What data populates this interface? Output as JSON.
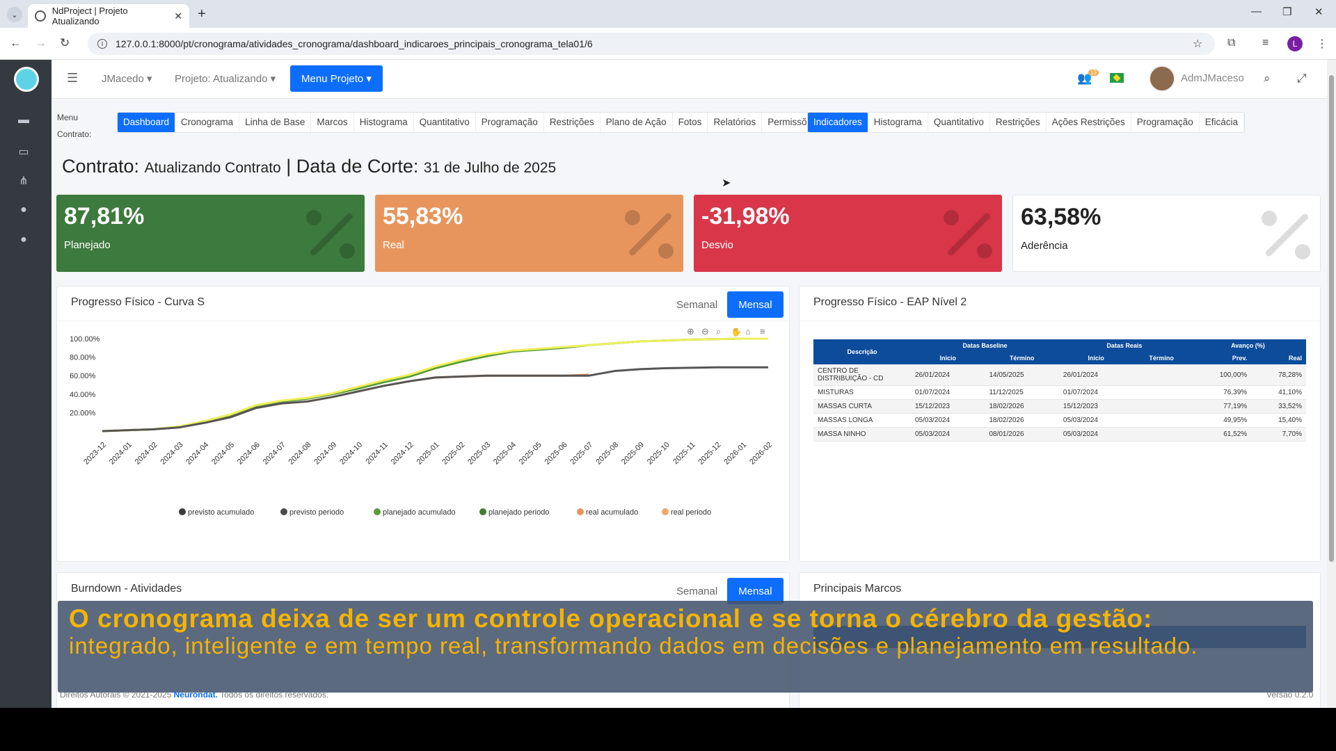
{
  "browser": {
    "tab_title": "NdProject | Projeto Atualizando",
    "url": "127.0.0.1:8000/pt/cronograma/atividades_cronograma/dashboard_indicaroes_principais_cronograma_tela01/6",
    "profile_initial": "L"
  },
  "header": {
    "user_dropdown": "JMacedo",
    "project_dropdown": "Projeto: Atualizando",
    "menu_button": "Menu Projeto",
    "notifications_count": "13",
    "username": "AdmJMaceso"
  },
  "submenu": {
    "label_line1": "Menu",
    "label_line2": "Contrato:",
    "group1": [
      "Dashboard",
      "Cronograma",
      "Linha de Base",
      "Marcos",
      "Histograma",
      "Quantitativo",
      "Programação",
      "Restrições",
      "Plano de Ação",
      "Fotos",
      "Relatórios",
      "Permissões"
    ],
    "group2": [
      "Indicadores",
      "Histograma",
      "Quantitativo",
      "Restrições",
      "Ações Restrições",
      "Programação",
      "Eficácia"
    ]
  },
  "contract": {
    "label": "Contrato:",
    "name": "Atualizando Contrato",
    "separator": "|",
    "cut_label": "Data de Corte:",
    "cut_date": "31 de Julho de 2025"
  },
  "kpis": [
    {
      "value": "87,81%",
      "label": "Planejado",
      "color": "#3d7a3d"
    },
    {
      "value": "55,83%",
      "label": "Real",
      "color": "#e8955d"
    },
    {
      "value": "-31,98%",
      "label": "Desvio",
      "color": "#d9364a"
    },
    {
      "value": "63,58%",
      "label": "Aderência",
      "color": "#ffffff"
    }
  ],
  "curve_panel": {
    "title": "Progresso Físico - Curva S",
    "btn_semanal": "Semanal",
    "btn_mensal": "Mensal"
  },
  "chart_data": {
    "type": "line",
    "title": "",
    "y_tick_labels": [
      "20.00%",
      "40.00%",
      "60.00%",
      "80.00%",
      "100.00%"
    ],
    "ylim": [
      0,
      100
    ],
    "categories": [
      "2023-12",
      "2024-01",
      "2024-02",
      "2024-03",
      "2024-04",
      "2024-05",
      "2024-06",
      "2024-07",
      "2024-08",
      "2024-09",
      "2024-10",
      "2024-11",
      "2024-12",
      "2025-01",
      "2025-02",
      "2025-03",
      "2025-04",
      "2025-05",
      "2025-06",
      "2025-07",
      "2025-08",
      "2025-09",
      "2025-10",
      "2025-11",
      "2025-12",
      "2026-01",
      "2026-02"
    ],
    "series": [
      {
        "name": "previsto acumulado",
        "color": "#3a3a3a",
        "values": [
          null,
          null,
          null,
          null,
          null,
          null,
          null,
          null,
          null,
          null,
          null,
          null,
          null,
          null,
          null,
          null,
          null,
          null,
          null,
          null,
          null,
          null,
          null,
          null,
          null,
          null,
          null
        ]
      },
      {
        "name": "previsto periodo",
        "color": "#4a4a4a",
        "values": [
          null,
          null,
          null,
          null,
          null,
          null,
          null,
          null,
          null,
          null,
          null,
          null,
          null,
          null,
          null,
          null,
          null,
          null,
          null,
          null,
          null,
          null,
          null,
          null,
          null,
          null,
          null
        ]
      },
      {
        "name": "planejado acumulado",
        "color": "#5a9a3a",
        "values": [
          0,
          1,
          2,
          5,
          10,
          17,
          27,
          32,
          35,
          40,
          46,
          53,
          59,
          68,
          75,
          81,
          86,
          88,
          90,
          93,
          95,
          97,
          98,
          99,
          99.5,
          100,
          100
        ]
      },
      {
        "name": "planejado periodo",
        "color": "#3f7d2e",
        "values": [
          null,
          null,
          null,
          null,
          null,
          null,
          null,
          null,
          null,
          null,
          null,
          null,
          null,
          null,
          null,
          null,
          null,
          null,
          null,
          null,
          null,
          null,
          null,
          null,
          null,
          null,
          null
        ]
      },
      {
        "name": "real acumulado",
        "color": "#e8955d",
        "values": [
          0,
          1,
          2,
          4,
          9,
          15,
          25,
          30,
          32,
          37,
          43,
          49,
          54,
          58,
          59,
          60,
          60,
          60,
          60,
          61,
          null,
          null,
          null,
          null,
          null,
          null,
          null
        ]
      },
      {
        "name": "real periodo",
        "color": "#f0a868",
        "values": [
          null,
          null,
          null,
          null,
          null,
          null,
          null,
          null,
          null,
          null,
          null,
          null,
          null,
          null,
          null,
          null,
          null,
          null,
          null,
          null,
          null,
          null,
          null,
          null,
          null,
          null,
          null
        ]
      },
      {
        "name": "",
        "color": "#ecf05a",
        "values": [
          0,
          1,
          2,
          5,
          11,
          18,
          28,
          33,
          36,
          41,
          48,
          55,
          61,
          70,
          77,
          83,
          87,
          89,
          91,
          93,
          95,
          97,
          98,
          99,
          99.5,
          100,
          100
        ]
      },
      {
        "name": "",
        "color": "#555555",
        "values": [
          0,
          1,
          2,
          4,
          9,
          15,
          25,
          30,
          32,
          37,
          43,
          49,
          54,
          58,
          59,
          60,
          60,
          60,
          60,
          60,
          65,
          67,
          68,
          68.5,
          69,
          69,
          69
        ]
      }
    ]
  },
  "eap_panel": {
    "title": "Progresso Físico - EAP Nível 2",
    "head_descricao": "Descrição",
    "head_baseline": "Datas Baseline",
    "head_reais": "Datas Reais",
    "head_avanco": "Avanço (%)",
    "sub_inicio": "Início",
    "sub_termino": "Término",
    "sub_prev": "Prev.",
    "sub_real": "Real",
    "rows": [
      {
        "desc": "CENTRO DE DISTRIBUIÇÃO - CD",
        "b_ini": "26/01/2024",
        "b_fim": "14/05/2025",
        "r_ini": "26/01/2024",
        "r_fim": "",
        "prev": "100,00%",
        "real": "78,28%"
      },
      {
        "desc": "MISTURAS",
        "b_ini": "01/07/2024",
        "b_fim": "11/12/2025",
        "r_ini": "01/07/2024",
        "r_fim": "",
        "prev": "76,39%",
        "real": "41,10%"
      },
      {
        "desc": "MASSAS CURTA",
        "b_ini": "15/12/2023",
        "b_fim": "18/02/2026",
        "r_ini": "15/12/2023",
        "r_fim": "",
        "prev": "77,19%",
        "real": "33,52%"
      },
      {
        "desc": "MASSAS LONGA",
        "b_ini": "05/03/2024",
        "b_fim": "18/02/2026",
        "r_ini": "05/03/2024",
        "r_fim": "",
        "prev": "49,95%",
        "real": "15,40%"
      },
      {
        "desc": "MASSA NINHO",
        "b_ini": "05/03/2024",
        "b_fim": "08/01/2026",
        "r_ini": "05/03/2024",
        "r_fim": "",
        "prev": "61,52%",
        "real": "7,70%"
      }
    ]
  },
  "burndown_panel": {
    "title": "Burndown - Atividades",
    "btn_semanal": "Semanal",
    "btn_mensal": "Mensal"
  },
  "marcos_panel": {
    "title": "Principais Marcos"
  },
  "caption": {
    "line1": "O cronograma deixa de ser um controle operacional e se torna o cérebro da gestão:",
    "line2": "integrado, inteligente e em tempo real, transformando dados em decisões e planejamento em resultado."
  },
  "footer": {
    "prefix": "Direitos Autorais © 2021-2025",
    "company": "Neurondat.",
    "suffix": "Todos os direitos reservados.",
    "version": "Versão 0.2.0"
  }
}
